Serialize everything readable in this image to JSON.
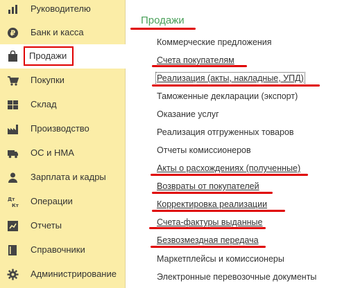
{
  "sidebar": {
    "items": [
      {
        "label": "Руководителю",
        "icon": "chart-icon"
      },
      {
        "label": "Банк и касса",
        "icon": "ruble-coin-icon"
      },
      {
        "label": "Продажи",
        "icon": "shopping-bag-icon",
        "active": true
      },
      {
        "label": "Покупки",
        "icon": "shopping-cart-icon"
      },
      {
        "label": "Склад",
        "icon": "warehouse-grid-icon"
      },
      {
        "label": "Производство",
        "icon": "factory-icon"
      },
      {
        "label": "ОС и НМА",
        "icon": "truck-icon"
      },
      {
        "label": "Зарплата и кадры",
        "icon": "person-icon"
      },
      {
        "label": "Операции",
        "icon": "debit-credit-icon",
        "icon_text_top": "Дт",
        "icon_text_bottom": "Кт"
      },
      {
        "label": "Отчеты",
        "icon": "report-chart-icon"
      },
      {
        "label": "Справочники",
        "icon": "book-icon"
      },
      {
        "label": "Администрирование",
        "icon": "gear-icon"
      }
    ]
  },
  "main": {
    "title": "Продажи",
    "commands": [
      {
        "label": "Коммерческие предложения",
        "highlighted": false
      },
      {
        "label": "Счета покупателям",
        "highlighted": true
      },
      {
        "label": "Реализация (акты, накладные, УПД)",
        "highlighted": true,
        "focused": true
      },
      {
        "label": "Таможенные декларации (экспорт)",
        "highlighted": false
      },
      {
        "label": "Оказание услуг",
        "highlighted": false
      },
      {
        "label": "Реализация отгруженных товаров",
        "highlighted": false
      },
      {
        "label": "Отчеты комиссионеров",
        "highlighted": false
      },
      {
        "label": "Акты о расхождениях (полученные)",
        "highlighted": true
      },
      {
        "label": "Возвраты от покупателей",
        "highlighted": true
      },
      {
        "label": "Корректировка реализации",
        "highlighted": true
      },
      {
        "label": "Счета-фактуры выданные",
        "highlighted": true
      },
      {
        "label": "Безвозмездная передача",
        "highlighted": true
      },
      {
        "label": "Маркетплейсы и комиссионеры",
        "highlighted": false
      },
      {
        "label": "Электронные перевозочные документы",
        "highlighted": false
      }
    ]
  },
  "colors": {
    "sidebar_bg": "#fbeda7",
    "title_green": "#4aa05a",
    "annotation_red": "#e00000",
    "text": "#333333"
  }
}
